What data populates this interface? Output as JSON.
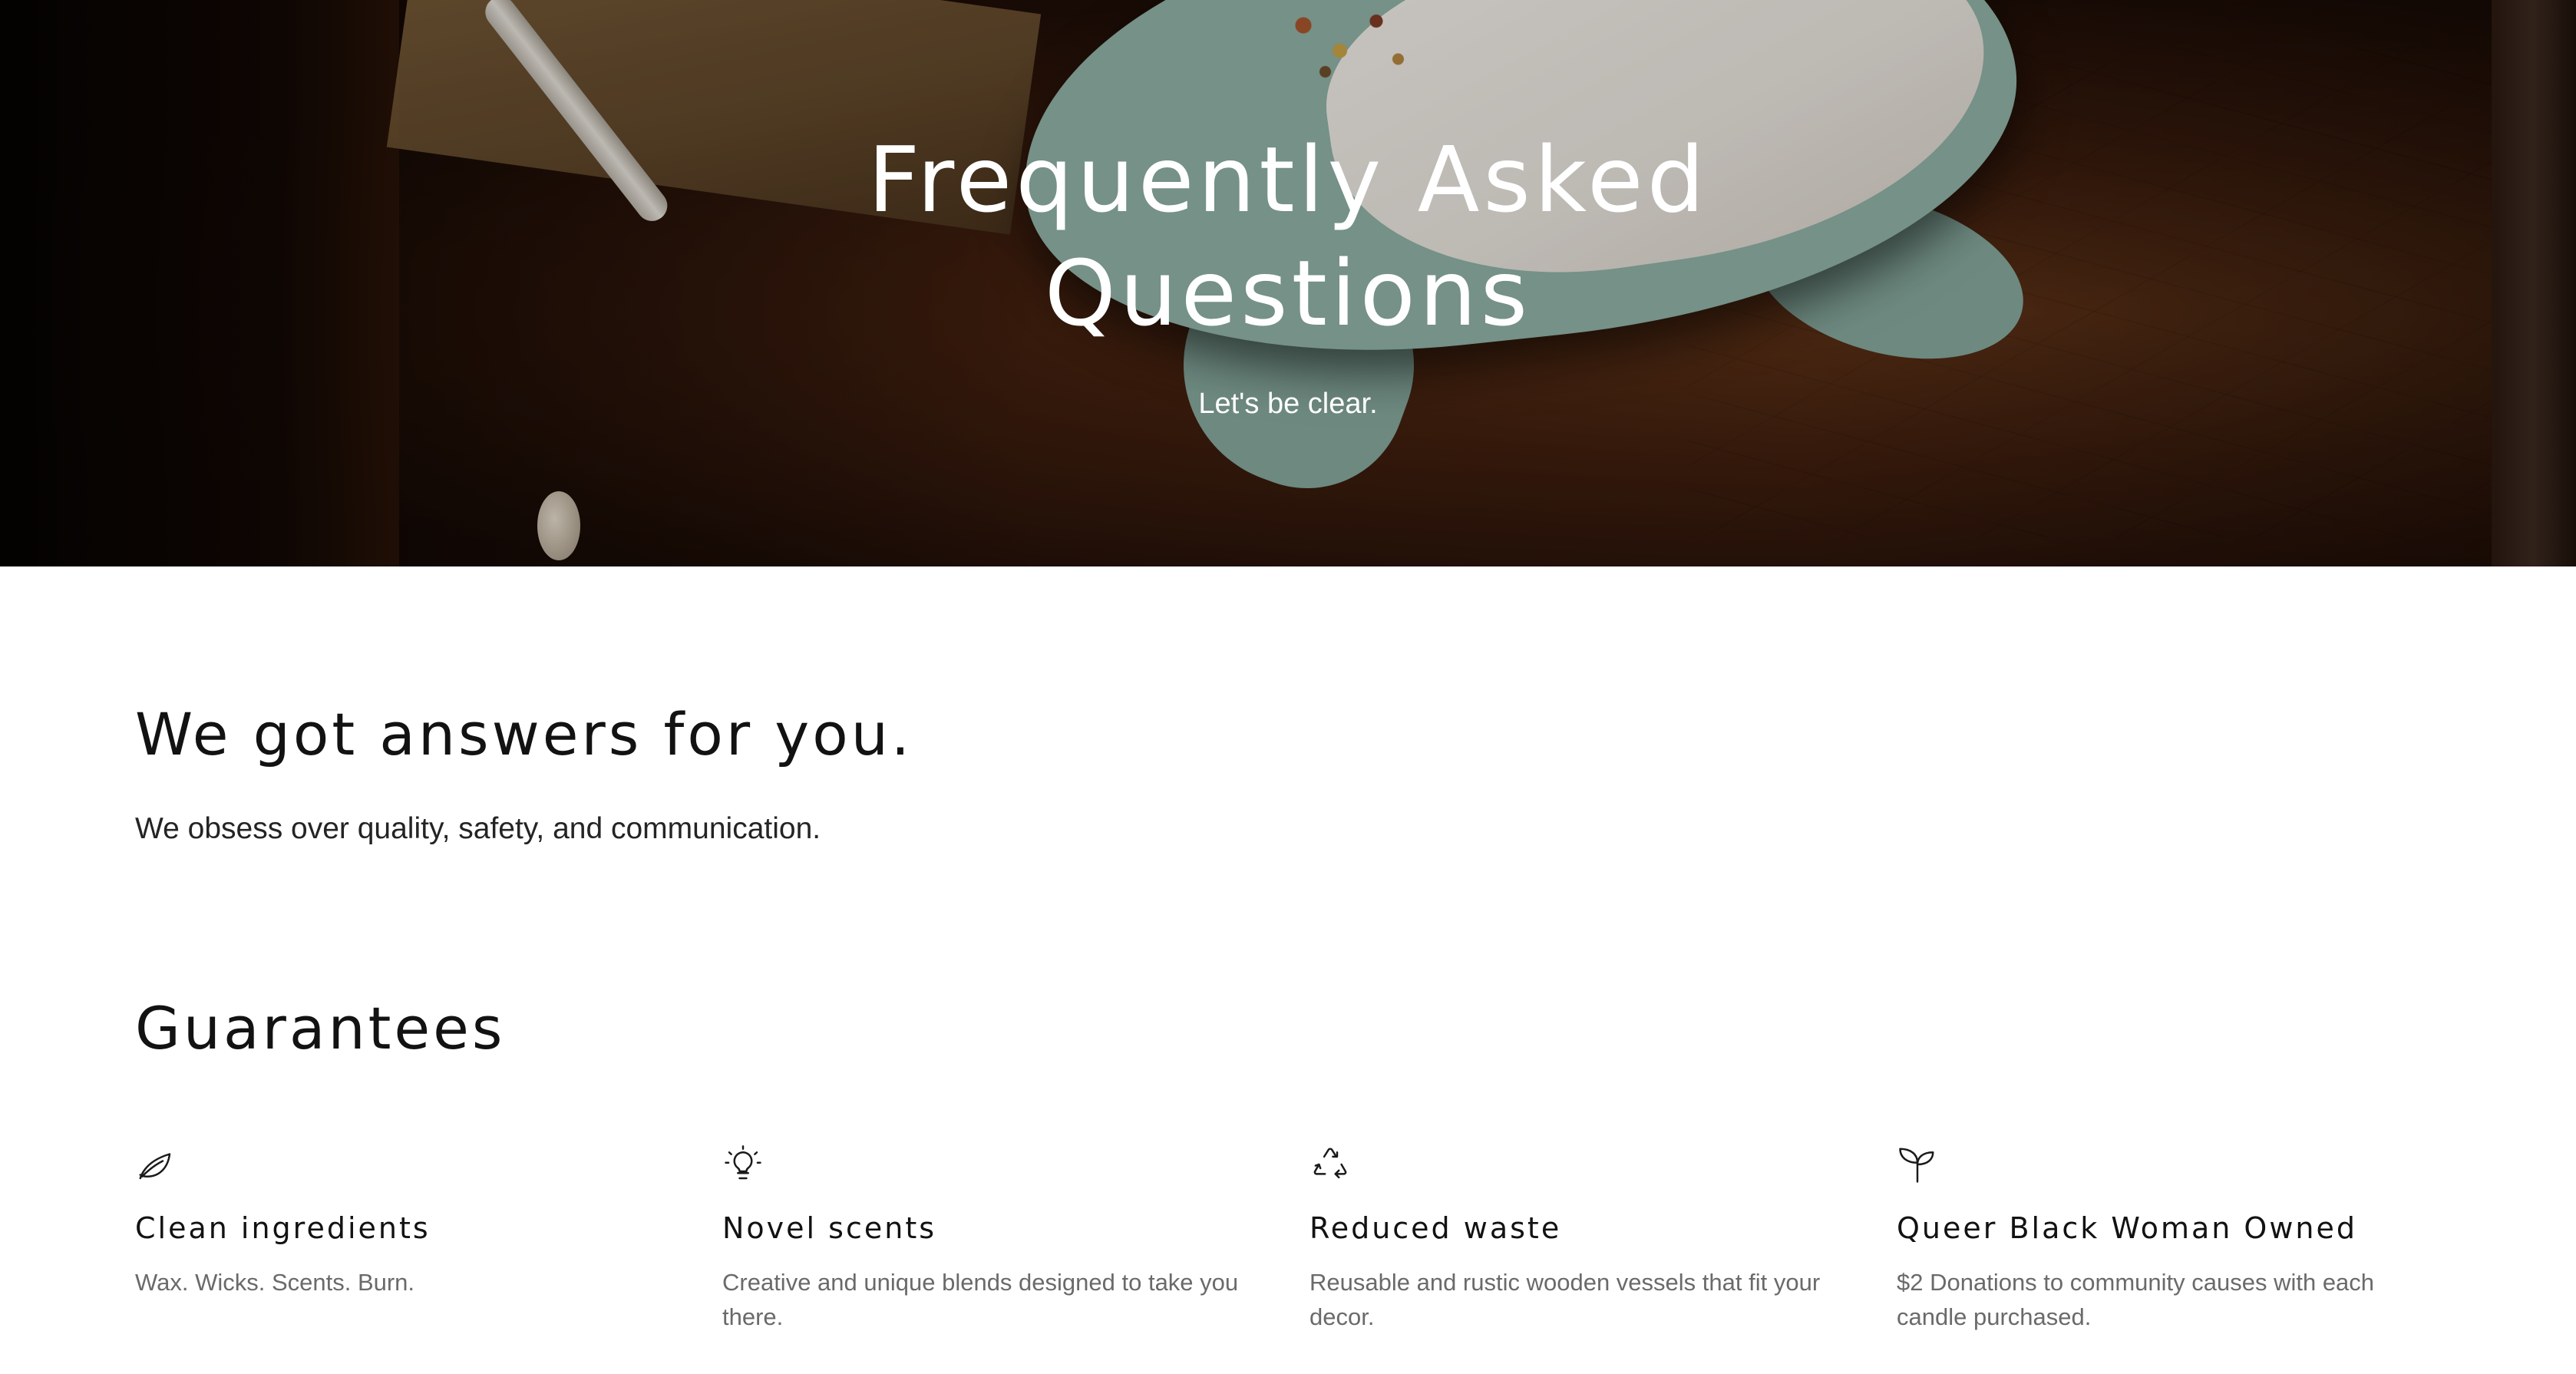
{
  "hero": {
    "title_line1": "Frequently Asked",
    "title_line2": "Questions",
    "subtitle": "Let's be clear."
  },
  "intro": {
    "title": "We got answers for you.",
    "text": "We obsess over quality, safety, and communication."
  },
  "guarantees": {
    "title": "Guarantees",
    "items": [
      {
        "icon": "leaf-icon",
        "title": "Clean ingredients",
        "text": "Wax. Wicks. Scents. Burn."
      },
      {
        "icon": "lightbulb-icon",
        "title": "Novel scents",
        "text": "Creative and unique blends designed to take you there."
      },
      {
        "icon": "recycle-icon",
        "title": "Reduced waste",
        "text": "Reusable and rustic wooden vessels that fit your decor."
      },
      {
        "icon": "sprout-icon",
        "title": "Queer Black Woman Owned",
        "text": "$2 Donations to community causes with each candle purchased."
      }
    ]
  },
  "colors": {
    "text_dark": "#121212",
    "text_muted": "#6a6a6a",
    "hero_text": "#ffffff"
  }
}
